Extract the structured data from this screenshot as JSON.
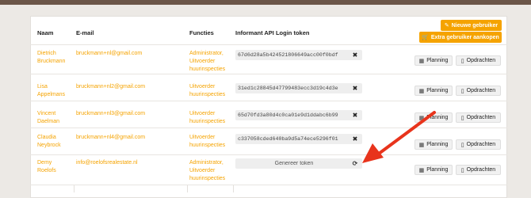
{
  "header": {
    "naam": "Naam",
    "email": "E-mail",
    "functies": "Functies",
    "token": "Informant API Login token"
  },
  "actions": {
    "new_user": "Nieuwe gebruiker",
    "new_user_icon": "pencil-icon",
    "extra_user": "Extra gebruiker aankopen",
    "extra_user_icon": "cart-icon"
  },
  "row_buttons": {
    "planning": "Planning",
    "opdrachten": "Opdrachten"
  },
  "users": [
    {
      "first": "Dietrich",
      "last": "Bruckmann",
      "email": "bruckmann+nl@gmail.com",
      "func1": "Administrator,",
      "func2": "Uitvoerder",
      "func3": "huurinspecties",
      "token": "67d6d28a5b424521806649acc00f0bdf"
    },
    {
      "first": "Lisa",
      "last": "Appelmans",
      "email": "bruckmann+nl2@gmail.com",
      "func1": "Uitvoerder",
      "func2": "huurinspecties",
      "func3": "",
      "token": "31ed1c28845d47799483ecc3d19c4d3e"
    },
    {
      "first": "Vincent",
      "last": "Daelman",
      "email": "bruckmann+nl3@gmail.com",
      "func1": "Uitvoerder",
      "func2": "huurinspecties",
      "func3": "",
      "token": "65d70fd3a80d4c0ca01e9d1ddabc6b99"
    },
    {
      "first": "Claudia",
      "last": "Neybrock",
      "email": "bruckmann+nl4@gmail.com",
      "func1": "Uitvoerder",
      "func2": "huurinspecties",
      "func3": "",
      "token": "c337058cded640ba9d5a74ece5296f01"
    },
    {
      "first": "Demy",
      "last": "Roelofs",
      "email": "info@roelofsrealestate.nl",
      "func1": "Administrator,",
      "func2": "Uitvoerder",
      "func3": "huurinspecties",
      "token": "Genereer token"
    }
  ],
  "colors": {
    "accent": "#f5a300",
    "arrow": "#e8341c",
    "topbar": "#6b5648"
  }
}
